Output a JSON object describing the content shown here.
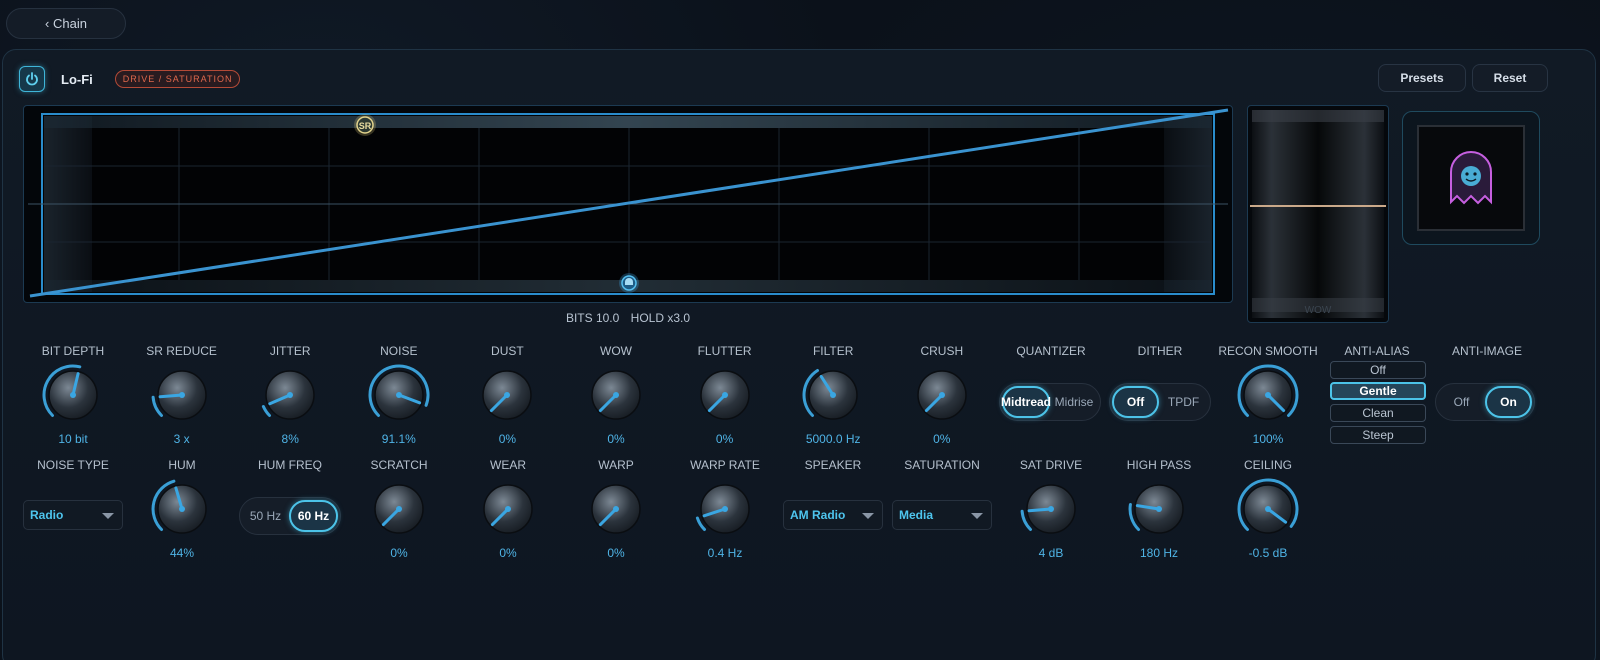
{
  "nav": {
    "back_label": "‹ Chain"
  },
  "header": {
    "plugin_name": "Lo-Fi",
    "category": "Drive / Saturation",
    "presets_label": "Presets",
    "reset_label": "Reset",
    "power_icon": "power-icon"
  },
  "display": {
    "handle_top_label": "SR",
    "meter_label": "WOW",
    "readout_bits": "BITS 10.0",
    "readout_hold": "HOLD x3.0"
  },
  "row1": [
    {
      "label": "BIT DEPTH",
      "value": "10 bit",
      "level": 0.55
    },
    {
      "label": "SR REDUCE",
      "value": "3 x",
      "level": 0.15
    },
    {
      "label": "JITTER",
      "value": "8%",
      "level": 0.08
    },
    {
      "label": "NOISE",
      "value": "91.1%",
      "level": 0.91
    },
    {
      "label": "DUST",
      "value": "0%",
      "level": 0.0
    },
    {
      "label": "WOW",
      "value": "0%",
      "level": 0.0
    },
    {
      "label": "FLUTTER",
      "value": "0%",
      "level": 0.0
    },
    {
      "label": "FILTER",
      "value": "5000.0 Hz",
      "level": 0.38
    },
    {
      "label": "CRUSH",
      "value": "0%",
      "level": 0.0
    }
  ],
  "quantizer": {
    "label": "QUANTIZER",
    "options": [
      "Midtread",
      "Midrise"
    ],
    "selected": "Midtread"
  },
  "dither": {
    "label": "DITHER",
    "options": [
      "Off",
      "TPDF"
    ],
    "selected": "Off"
  },
  "recon_smooth": {
    "label": "RECON SMOOTH",
    "value": "100%",
    "level": 1.0
  },
  "anti_alias": {
    "label": "ANTI-ALIAS",
    "options": [
      "Off",
      "Gentle",
      "Clean",
      "Steep"
    ],
    "selected": "Gentle"
  },
  "anti_image": {
    "label": "ANTI-IMAGE",
    "options": [
      "Off",
      "On"
    ],
    "selected": "On"
  },
  "noise_type": {
    "label": "NOISE TYPE",
    "value": "Radio"
  },
  "row2": [
    {
      "label": "HUM",
      "value": "44%",
      "level": 0.44
    },
    {
      "label": "SCRATCH",
      "value": "0%",
      "level": 0.0
    },
    {
      "label": "WEAR",
      "value": "0%",
      "level": 0.0
    },
    {
      "label": "WARP",
      "value": "0%",
      "level": 0.0
    },
    {
      "label": "WARP RATE",
      "value": "0.4 Hz",
      "level": 0.1
    },
    {
      "label": "SAT DRIVE",
      "value": "4 dB",
      "level": 0.15
    },
    {
      "label": "HIGH PASS",
      "value": "180 Hz",
      "level": 0.2
    },
    {
      "label": "CEILING",
      "value": "-0.5 dB",
      "level": 0.97
    }
  ],
  "hum_freq": {
    "label": "HUM FREQ",
    "options": [
      "50 Hz",
      "60 Hz"
    ],
    "selected": "60 Hz"
  },
  "speaker": {
    "label": "SPEAKER",
    "value": "AM Radio"
  },
  "saturation": {
    "label": "SATURATION",
    "value": "Media"
  },
  "colors": {
    "accent": "#4cc3e8",
    "value_text": "#4fb4e6",
    "badge": "#e0684c"
  }
}
